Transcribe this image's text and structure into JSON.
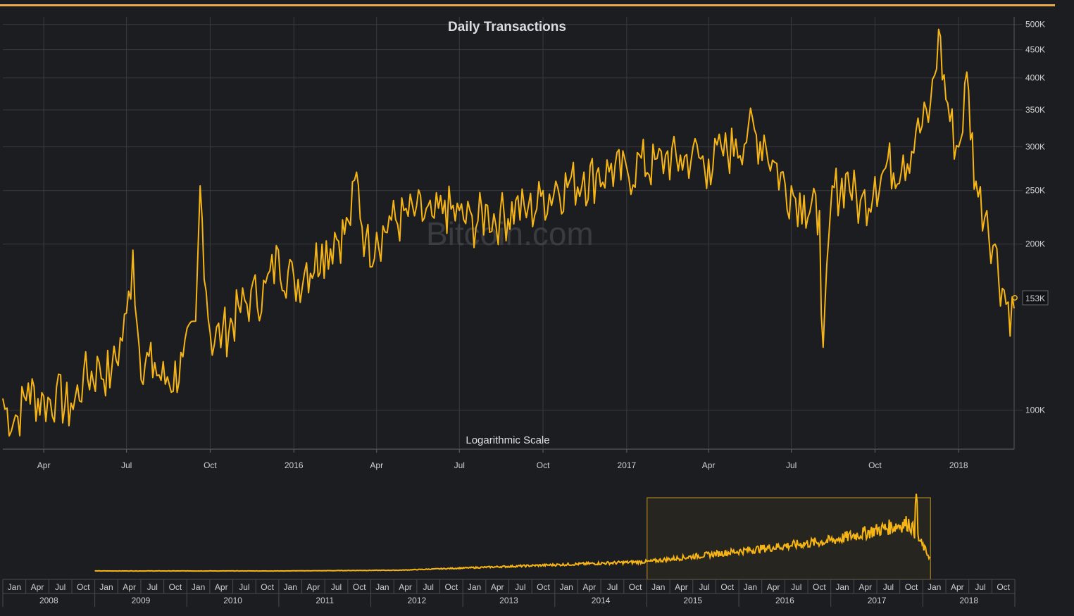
{
  "chart_data": {
    "type": "line",
    "title": "Daily Transactions",
    "subtitle": "Logarithmic Scale",
    "watermark": "Bitcoin.com",
    "y_scale": "logarithmic",
    "ylim": [
      85000,
      510000
    ],
    "y_ticks": [
      {
        "value": 100000,
        "label": "100K"
      },
      {
        "value": 200000,
        "label": "200K"
      },
      {
        "value": 250000,
        "label": "250K"
      },
      {
        "value": 300000,
        "label": "300K"
      },
      {
        "value": 350000,
        "label": "350K"
      },
      {
        "value": 400000,
        "label": "400K"
      },
      {
        "value": 450000,
        "label": "450K"
      },
      {
        "value": 500000,
        "label": "500K"
      }
    ],
    "x_range": [
      "2015-02-15",
      "2018-03-03"
    ],
    "x_ticks": [
      {
        "date": "2015-04-01",
        "label": "Apr"
      },
      {
        "date": "2015-07-01",
        "label": "Jul"
      },
      {
        "date": "2015-10-01",
        "label": "Oct"
      },
      {
        "date": "2016-01-01",
        "label": "2016"
      },
      {
        "date": "2016-04-01",
        "label": "Apr"
      },
      {
        "date": "2016-07-01",
        "label": "Jul"
      },
      {
        "date": "2016-10-01",
        "label": "Oct"
      },
      {
        "date": "2017-01-01",
        "label": "2017"
      },
      {
        "date": "2017-04-01",
        "label": "Apr"
      },
      {
        "date": "2017-07-01",
        "label": "Jul"
      },
      {
        "date": "2017-10-01",
        "label": "Oct"
      },
      {
        "date": "2018-01-01",
        "label": "2018"
      }
    ],
    "last_value_label": "153K",
    "last_value": 153000,
    "series": [
      {
        "name": "Daily Transactions",
        "color": "#f7b515",
        "points": [
          [
            "2015-02-15",
            105000
          ],
          [
            "2015-03-01",
            98000
          ],
          [
            "2015-03-15",
            112000
          ],
          [
            "2015-04-01",
            106000
          ],
          [
            "2015-04-15",
            110000
          ],
          [
            "2015-05-01",
            103000
          ],
          [
            "2015-05-15",
            118000
          ],
          [
            "2015-06-01",
            122000
          ],
          [
            "2015-06-15",
            120000
          ],
          [
            "2015-07-01",
            150000
          ],
          [
            "2015-07-08",
            195000
          ],
          [
            "2015-07-15",
            130000
          ],
          [
            "2015-08-01",
            122000
          ],
          [
            "2015-08-15",
            115000
          ],
          [
            "2015-09-01",
            125000
          ],
          [
            "2015-09-15",
            145000
          ],
          [
            "2015-09-20",
            255000
          ],
          [
            "2015-10-01",
            138000
          ],
          [
            "2015-10-15",
            142000
          ],
          [
            "2015-11-01",
            155000
          ],
          [
            "2015-11-15",
            165000
          ],
          [
            "2015-12-01",
            170000
          ],
          [
            "2015-12-15",
            195000
          ],
          [
            "2016-01-01",
            175000
          ],
          [
            "2016-01-15",
            185000
          ],
          [
            "2016-02-01",
            200000
          ],
          [
            "2016-02-15",
            210000
          ],
          [
            "2016-03-01",
            220000
          ],
          [
            "2016-03-10",
            270000
          ],
          [
            "2016-03-20",
            205000
          ],
          [
            "2016-04-01",
            210000
          ],
          [
            "2016-04-15",
            225000
          ],
          [
            "2016-05-01",
            230000
          ],
          [
            "2016-05-15",
            235000
          ],
          [
            "2016-06-01",
            225000
          ],
          [
            "2016-06-15",
            240000
          ],
          [
            "2016-07-01",
            230000
          ],
          [
            "2016-07-15",
            225000
          ],
          [
            "2016-08-01",
            235000
          ],
          [
            "2016-08-15",
            230000
          ],
          [
            "2016-09-01",
            240000
          ],
          [
            "2016-09-15",
            235000
          ],
          [
            "2016-10-01",
            250000
          ],
          [
            "2016-10-15",
            260000
          ],
          [
            "2016-11-01",
            265000
          ],
          [
            "2016-11-15",
            270000
          ],
          [
            "2016-12-01",
            275000
          ],
          [
            "2016-12-15",
            280000
          ],
          [
            "2017-01-01",
            275000
          ],
          [
            "2017-01-15",
            290000
          ],
          [
            "2017-02-01",
            285000
          ],
          [
            "2017-02-15",
            295000
          ],
          [
            "2017-03-01",
            290000
          ],
          [
            "2017-03-15",
            300000
          ],
          [
            "2017-04-01",
            285000
          ],
          [
            "2017-04-15",
            300000
          ],
          [
            "2017-05-01",
            310000
          ],
          [
            "2017-05-15",
            330000
          ],
          [
            "2017-06-01",
            315000
          ],
          [
            "2017-06-15",
            280000
          ],
          [
            "2017-07-01",
            255000
          ],
          [
            "2017-07-15",
            245000
          ],
          [
            "2017-08-01",
            230000
          ],
          [
            "2017-08-05",
            130000
          ],
          [
            "2017-08-15",
            255000
          ],
          [
            "2017-09-01",
            270000
          ],
          [
            "2017-09-15",
            240000
          ],
          [
            "2017-10-01",
            265000
          ],
          [
            "2017-10-15",
            285000
          ],
          [
            "2017-11-01",
            290000
          ],
          [
            "2017-11-15",
            320000
          ],
          [
            "2017-12-01",
            360000
          ],
          [
            "2017-12-10",
            490000
          ],
          [
            "2017-12-20",
            360000
          ],
          [
            "2018-01-01",
            300000
          ],
          [
            "2018-01-10",
            410000
          ],
          [
            "2018-01-20",
            260000
          ],
          [
            "2018-02-01",
            230000
          ],
          [
            "2018-02-10",
            200000
          ],
          [
            "2018-02-20",
            165000
          ],
          [
            "2018-03-03",
            153000
          ]
        ]
      }
    ],
    "navigator": {
      "years": [
        "2008",
        "2009",
        "2010",
        "2011",
        "2012",
        "2013",
        "2014",
        "2015",
        "2016",
        "2017",
        "2018"
      ],
      "months": [
        "Jan",
        "Apr",
        "Jul",
        "Oct"
      ],
      "selection": [
        "2015-01-01",
        "2018-01-31"
      ]
    }
  }
}
